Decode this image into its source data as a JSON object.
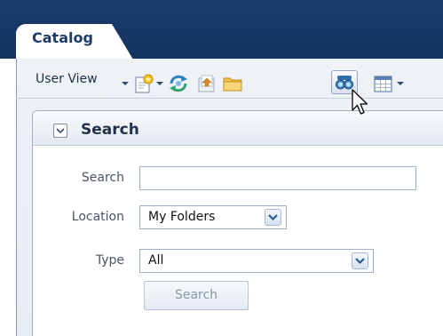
{
  "tab": {
    "title": "Catalog"
  },
  "toolbar": {
    "view_label": "User View",
    "icons": [
      "new-item-icon",
      "sync-icon",
      "upload-icon",
      "folder-icon",
      "find-icon",
      "view-grid-icon"
    ]
  },
  "search_panel": {
    "title": "Search",
    "fields": {
      "search_label": "Search",
      "search_value": "",
      "location_label": "Location",
      "location_value": "My Folders",
      "type_label": "Type",
      "type_value": "All"
    },
    "button_label": "Search"
  },
  "colors": {
    "tab_strip": "#1b3a6e",
    "panel_background": "#eef2f7",
    "border": "#a4b1c4",
    "disabled_text": "#8a96a8"
  }
}
